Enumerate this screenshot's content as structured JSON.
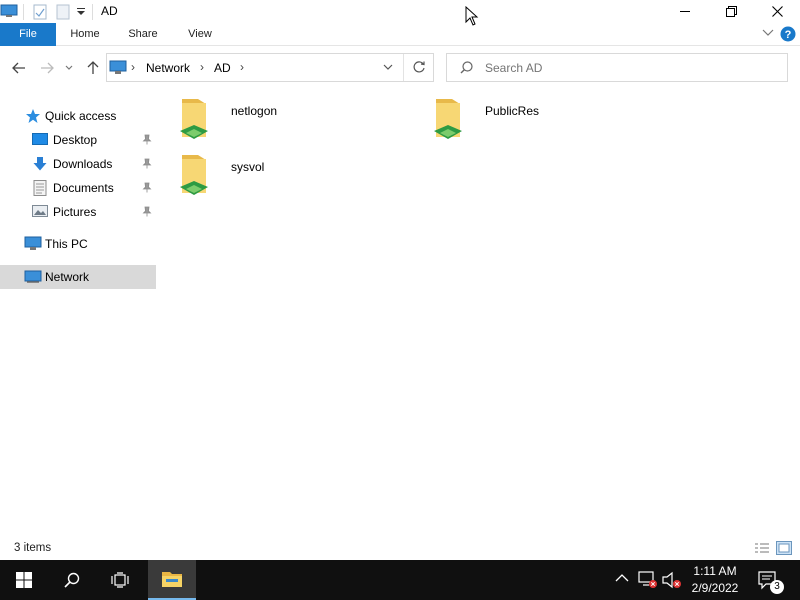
{
  "window": {
    "title": "AD"
  },
  "ribbon": {
    "tabs": [
      "File",
      "Home",
      "Share",
      "View"
    ]
  },
  "address": {
    "breadcrumb": [
      "Network",
      "AD"
    ]
  },
  "search": {
    "placeholder": "Search AD"
  },
  "nav": {
    "quick_access": "Quick access",
    "items": [
      {
        "label": "Desktop",
        "pinned": true,
        "icon": "desktop-icon"
      },
      {
        "label": "Downloads",
        "pinned": true,
        "icon": "downloads-icon"
      },
      {
        "label": "Documents",
        "pinned": true,
        "icon": "documents-icon"
      },
      {
        "label": "Pictures",
        "pinned": true,
        "icon": "pictures-icon"
      }
    ],
    "this_pc": "This PC",
    "network": "Network",
    "selected": "Network"
  },
  "content": {
    "items": [
      {
        "name": "netlogon",
        "icon": "shared-folder-icon"
      },
      {
        "name": "PublicRes",
        "icon": "shared-folder-icon"
      },
      {
        "name": "sysvol",
        "icon": "shared-folder-icon"
      }
    ]
  },
  "status": {
    "count": "3 items"
  },
  "taskbar": {
    "time": "1:11 AM",
    "date": "2/9/2022",
    "notification_count": "3"
  },
  "colors": {
    "accent": "#1979ca",
    "taskbar": "#101010",
    "selection": "#d9d9d9"
  }
}
